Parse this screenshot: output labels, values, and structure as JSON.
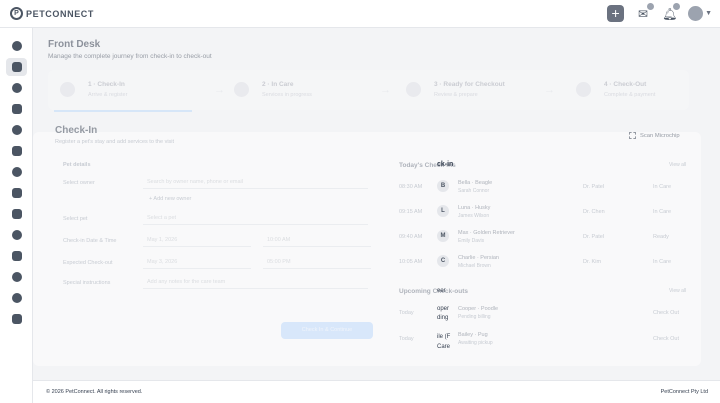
{
  "app": {
    "logo_mark": "P",
    "logo_text": "PETCONNECT"
  },
  "header": {
    "icons": [
      "plus-icon",
      "mail-check-icon",
      "bell-icon",
      "avatar",
      "chevron-down-icon"
    ]
  },
  "sidebar": {
    "items": [
      {
        "icon": "dashboard-icon",
        "active": false
      },
      {
        "icon": "front-desk-icon",
        "active": true
      },
      {
        "icon": "paw-icon",
        "active": false
      },
      {
        "icon": "chat-icon",
        "active": false
      },
      {
        "icon": "users-icon",
        "active": false
      },
      {
        "icon": "inbox-icon",
        "active": false
      },
      {
        "icon": "bell-icon",
        "active": false
      },
      {
        "icon": "calendar-icon",
        "active": false
      },
      {
        "icon": "calendar-check-icon",
        "active": false
      },
      {
        "icon": "report-icon",
        "active": false
      },
      {
        "icon": "hourglass-icon",
        "active": false
      },
      {
        "icon": "pill-icon",
        "active": false
      },
      {
        "icon": "chart-icon",
        "active": false
      },
      {
        "icon": "truck-icon",
        "active": false
      }
    ]
  },
  "page": {
    "title": "Front Desk",
    "subtitle": "Manage the complete journey from check-in to check-out"
  },
  "steps": [
    {
      "num": "1",
      "title": "Check-In",
      "desc": "Arrive & register"
    },
    {
      "num": "2",
      "title": "In Care",
      "desc": "Services in progress"
    },
    {
      "num": "3",
      "title": "Ready for Checkout",
      "desc": "Review & prepare"
    },
    {
      "num": "4",
      "title": "Check-Out",
      "desc": "Complete & payment"
    }
  ],
  "checkin": {
    "title": "Check-In",
    "subtitle": "Register a pet's stay and add services to the visit",
    "scan_label": "Scan Microchip",
    "section_label": "Pet details",
    "owner_label": "Select owner",
    "owner_placeholder": "Search by owner name, phone or email",
    "add_owner": "+ Add new owner",
    "pet_label": "Select pet",
    "pet_placeholder": "Select a pet",
    "checkin_label": "Check-in Date & Time",
    "checkin_date": "May 1, 2026",
    "checkin_time": "10:00 AM",
    "checkout_label": "Expected Check-out",
    "checkout_date": "May 3, 2026",
    "checkout_time": "05:00 PM",
    "notes_label": "Special instructions",
    "notes_placeholder": "Add any notes for the care team",
    "submit_label": "Check In & Continue"
  },
  "today": {
    "title": "Today's Check-ins",
    "link": "View all",
    "rows": [
      {
        "time": "08:30 AM",
        "initial": "B",
        "name": "Bella · Beagle",
        "pet": "Sarah Connor",
        "vet": "Dr. Patel",
        "action": "In Care"
      },
      {
        "time": "09:15 AM",
        "initial": "L",
        "name": "Luna · Husky",
        "pet": "James Wilson",
        "vet": "Dr. Chen",
        "action": "In Care"
      },
      {
        "time": "09:40 AM",
        "initial": "M",
        "name": "Max · Golden Retriever",
        "pet": "Emily Davis",
        "vet": "Dr. Patel",
        "action": "Ready"
      },
      {
        "time": "10:05 AM",
        "initial": "C",
        "name": "Charlie · Persian",
        "pet": "Michael Brown",
        "vet": "Dr. Kim",
        "action": "In Care"
      }
    ]
  },
  "upcoming": {
    "title": "Upcoming Check-outs",
    "link": "View all",
    "rows": [
      {
        "time": "Today",
        "name": "Cooper · Poodle",
        "pet": "Pending billing",
        "action": "Check Out"
      },
      {
        "time": "Today",
        "name": "Bailey · Pug",
        "pet": "Awaiting pickup",
        "action": "Check Out"
      }
    ]
  },
  "overlay": {
    "title_frag": "ck-in",
    "fragments": [
      "eer",
      "oper",
      "ding",
      "ile (F",
      "Care"
    ]
  },
  "footer": {
    "left": "© 2026 PetConnect. All rights reserved.",
    "right": "PetConnect Pty Ltd"
  }
}
